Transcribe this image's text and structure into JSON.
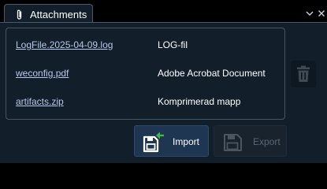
{
  "tab": {
    "label": "Attachments",
    "icon": "paperclip-icon"
  },
  "window_controls": {
    "collapse_icon": "chevron-down-icon",
    "close_icon": "close-icon"
  },
  "attachments": [
    {
      "name": "LogFile.2025-04-09.log",
      "type": "LOG-fil"
    },
    {
      "name": "weconfig.pdf",
      "type": "Adobe Acrobat Document"
    },
    {
      "name": "artifacts.zip",
      "type": "Komprimerad mapp"
    }
  ],
  "actions": {
    "delete_icon": "trash-icon",
    "import_label": "Import",
    "export_label": "Export",
    "import_enabled": true,
    "export_enabled": false
  },
  "colors": {
    "background": "#000000",
    "panel": "#121f2b",
    "border": "#435465",
    "link": "#b7c6ea",
    "accent_green": "#4bb543",
    "disabled_text": "#5a6672"
  }
}
